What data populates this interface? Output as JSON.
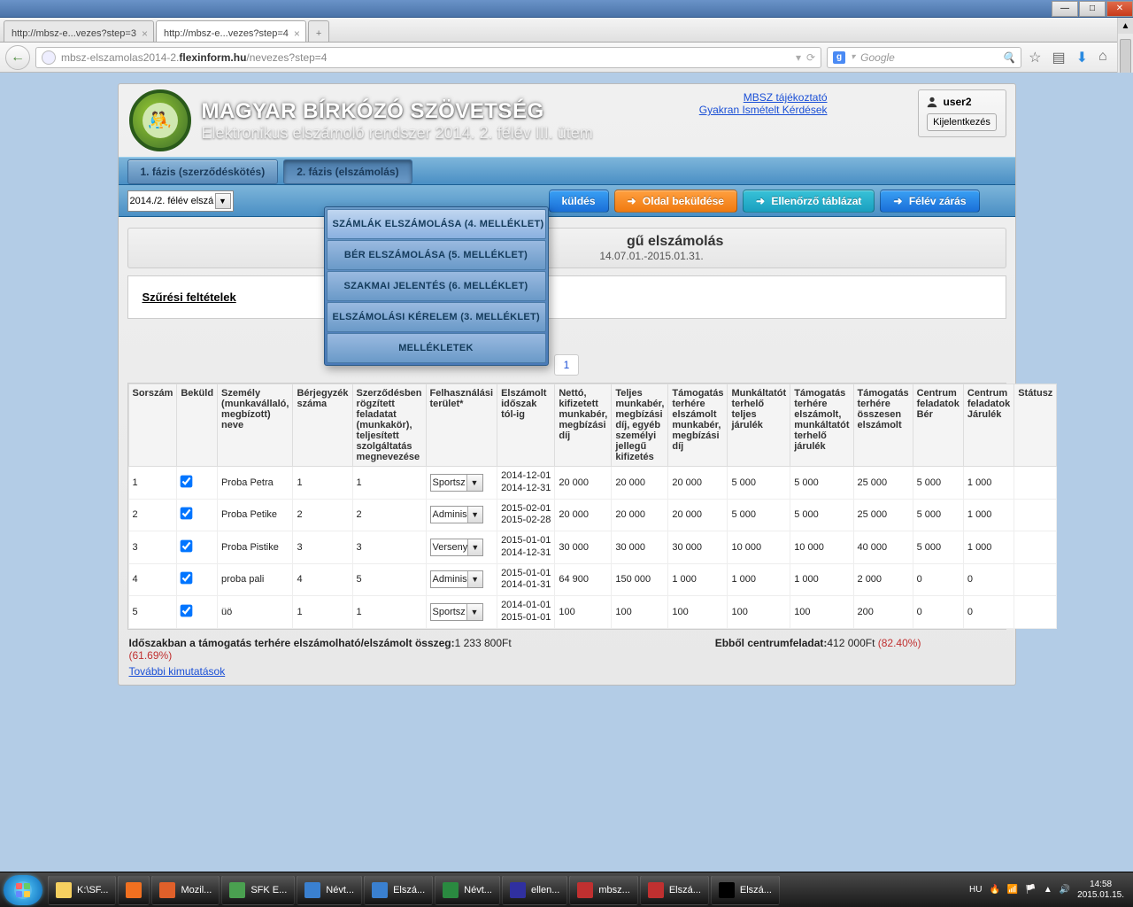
{
  "window": {
    "tab1": "http://mbsz-e...vezes?step=3",
    "tab2": "http://mbsz-e...vezes?step=4",
    "url_display_prefix": "mbsz-elszamolas2014-2.",
    "url_display_bold": "flexinform.hu",
    "url_display_suffix": "/nevezes?step=4",
    "search_placeholder": "Google"
  },
  "header": {
    "title": "MAGYAR BÍRKÓZÓ SZÖVETSÉG",
    "subtitle": "Elektronikus elszámoló rendszer 2014. 2. félév III. ütem",
    "link1": "MBSZ tájékoztató",
    "link2": "Gyakran Ismételt Kérdések",
    "user": "user2",
    "logout": "Kijelentkezés"
  },
  "phases": {
    "p1": "1. fázis (szerződéskötés)",
    "p2": "2. fázis (elszámolás)"
  },
  "toolbar": {
    "period": "2014./2. félév elszá",
    "submit": "küldés",
    "page_submit": "Oldal beküldése",
    "check_table": "Ellenőrző táblázat",
    "close_half": "Félév zárás"
  },
  "dropdown": {
    "i1": "SZÁMLÁK ELSZÁMOLÁSA (4. MELLÉKLET)",
    "i2": "BÉR ELSZÁMOLÁSA (5. MELLÉKLET)",
    "i3": "SZAKMAI JELENTÉS (6. MELLÉKLET)",
    "i4": "ELSZÁMOLÁSI KÉRELEM (3. MELLÉKLET)",
    "i5": "MELLÉKLETEK"
  },
  "banner": {
    "line1_suffix": "gű elszámolás",
    "line2_suffix": "14.07.01.-2015.01.31."
  },
  "filter_title": "Szűrési feltételek",
  "pager_current": "1",
  "columns": [
    "Sorszám",
    "Beküld",
    "Személy (munkavállaló, megbízott) neve",
    "Bérjegyzék száma",
    "Szerződésben rögzített feladatat (munkakör), teljesített szolgáltatás megnevezése",
    "Felhasználási terület*",
    "Elszámolt időszak tól-ig",
    "Nettó, kifizetett munkabér, megbízási díj",
    "Teljes munkabér, megbízási díj, egyéb személyi jellegű kifizetés",
    "Támogatás terhére elszámolt munkabér, megbízási díj",
    "Munkáltatót terhelő teljes járulék",
    "Támogatás terhére elszámolt, munkáltatót terhelő járulék",
    "Támogatás terhére összesen elszámolt",
    "Centrum feladatok Bér",
    "Centrum feladatok Járulék",
    "Státusz"
  ],
  "rows": [
    {
      "n": "1",
      "name": "Proba  Petra",
      "bj": "1",
      "sz": "1",
      "area": "Sportsz",
      "d1": "2014-12-01",
      "d2": "2014-12-31",
      "c": [
        "20 000",
        "20 000",
        "20 000",
        "5 000",
        "5 000",
        "25 000",
        "5 000",
        "1 000",
        ""
      ]
    },
    {
      "n": "2",
      "name": "Proba Petike",
      "bj": "2",
      "sz": "2",
      "area": "Adminis",
      "d1": "2015-02-01",
      "d2": "2015-02-28",
      "c": [
        "20 000",
        "20 000",
        "20 000",
        "5 000",
        "5 000",
        "25 000",
        "5 000",
        "1 000",
        ""
      ]
    },
    {
      "n": "3",
      "name": "Proba Pistike",
      "bj": "3",
      "sz": "3",
      "area": "Verseny",
      "d1": "2015-01-01",
      "d2": "2014-12-31",
      "c": [
        "30 000",
        "30 000",
        "30 000",
        "10 000",
        "10 000",
        "40 000",
        "5 000",
        "1 000",
        ""
      ]
    },
    {
      "n": "4",
      "name": "proba pali",
      "bj": "4",
      "sz": "5",
      "area": "Adminis",
      "d1": "2015-01-01",
      "d2": "2014-01-31",
      "c": [
        "64 900",
        "150 000",
        "1 000",
        "1 000",
        "1 000",
        "2 000",
        "0",
        "0",
        ""
      ]
    },
    {
      "n": "5",
      "name": "üö",
      "bj": "1",
      "sz": "1",
      "area": "Sportsz",
      "d1": "2014-01-01",
      "d2": "2015-01-01",
      "c": [
        "100",
        "100",
        "100",
        "100",
        "100",
        "200",
        "0",
        "0",
        ""
      ]
    }
  ],
  "totals": {
    "left_label": "Időszakban a támogatás terhére elszámolható/elszámolt összeg:",
    "left_val": "1 233 800Ft",
    "left_pct": "(61.69%)",
    "right_label": "Ebből centrumfeladat:",
    "right_val": "412 000Ft ",
    "right_pct": "(82.40%)"
  },
  "more_link": "További kimutatások",
  "taskbar": {
    "items": [
      "K:\\SF...",
      "",
      "Mozil...",
      "SFK E...",
      "Névt...",
      "Elszá...",
      "Névt...",
      "ellen...",
      "mbsz...",
      "Elszá...",
      "Elszá..."
    ],
    "lang": "HU",
    "time": "14:58",
    "date": "2015.01.15."
  }
}
